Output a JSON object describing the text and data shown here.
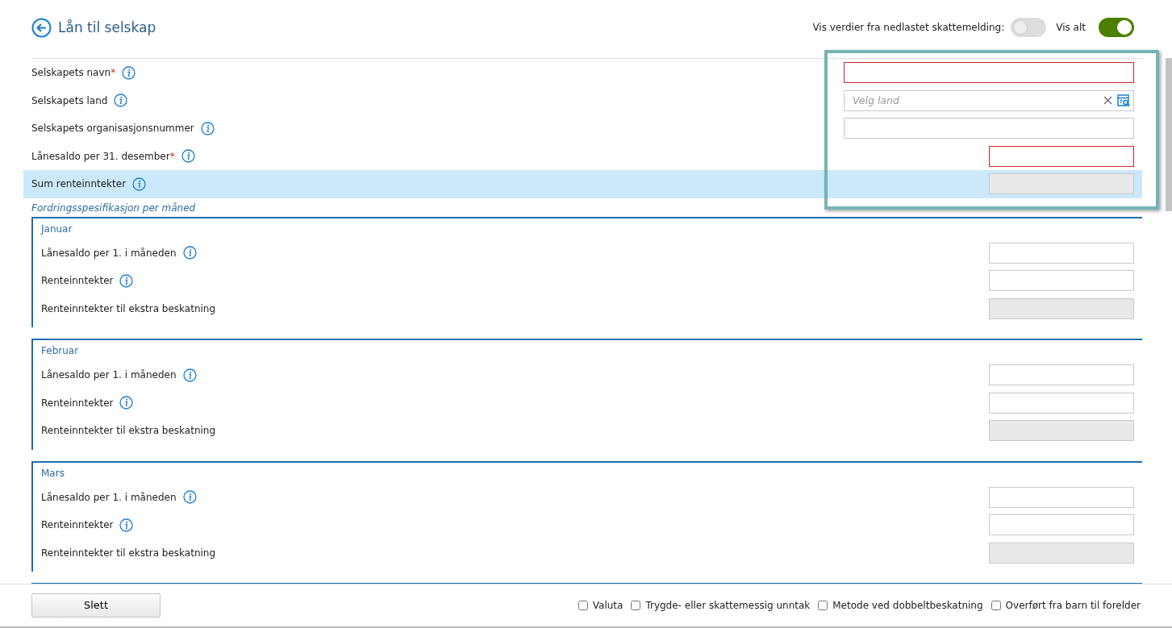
{
  "header": {
    "title": "Lån til selskap",
    "downloaded_label": "Vis verdier fra nedlastet skattemelding:",
    "downloaded_on": false,
    "show_all_label": "Vis alt",
    "show_all_on": true
  },
  "fields": [
    {
      "label": "Selskapets navn",
      "required_mark": "*",
      "kind": "text",
      "invalid": true
    },
    {
      "label": "Selskapets land",
      "kind": "lookup",
      "placeholder": "Velg land"
    },
    {
      "label": "Selskapets organisasjonsnummer",
      "kind": "text"
    },
    {
      "label": "Lånesaldo per 31. desember",
      "required_mark": "*",
      "kind": "amount",
      "invalid": true
    },
    {
      "label": "Sum renteinntekter",
      "kind": "readonly",
      "highlighted": true
    }
  ],
  "section_title": "Fordringsspesifikasjon per måned",
  "months": [
    {
      "name": "Januar",
      "fields": [
        {
          "label": "Lånesaldo per 1. i måneden",
          "info": true,
          "kind": "amount"
        },
        {
          "label": "Renteinntekter",
          "info": true,
          "kind": "amount"
        },
        {
          "label": "Renteinntekter til ekstra beskatning",
          "info": false,
          "kind": "readonly"
        }
      ]
    },
    {
      "name": "Februar",
      "fields": [
        {
          "label": "Lånesaldo per 1. i måneden",
          "info": true,
          "kind": "amount"
        },
        {
          "label": "Renteinntekter",
          "info": true,
          "kind": "amount"
        },
        {
          "label": "Renteinntekter til ekstra beskatning",
          "info": false,
          "kind": "readonly"
        }
      ]
    },
    {
      "name": "Mars",
      "fields": [
        {
          "label": "Lånesaldo per 1. i måneden",
          "info": true,
          "kind": "amount"
        },
        {
          "label": "Renteinntekter",
          "info": true,
          "kind": "amount"
        },
        {
          "label": "Renteinntekter til ekstra beskatning",
          "info": false,
          "kind": "readonly"
        }
      ]
    }
  ],
  "footer": {
    "delete_button": "Slett",
    "options": [
      {
        "label": "Valuta",
        "checked": false
      },
      {
        "label": "Trygde- eller skattemessig unntak",
        "checked": false
      },
      {
        "label": "Metode ved dobbeltbeskatning",
        "checked": false
      },
      {
        "label": "Overført fra barn til forelder",
        "checked": false
      }
    ]
  }
}
